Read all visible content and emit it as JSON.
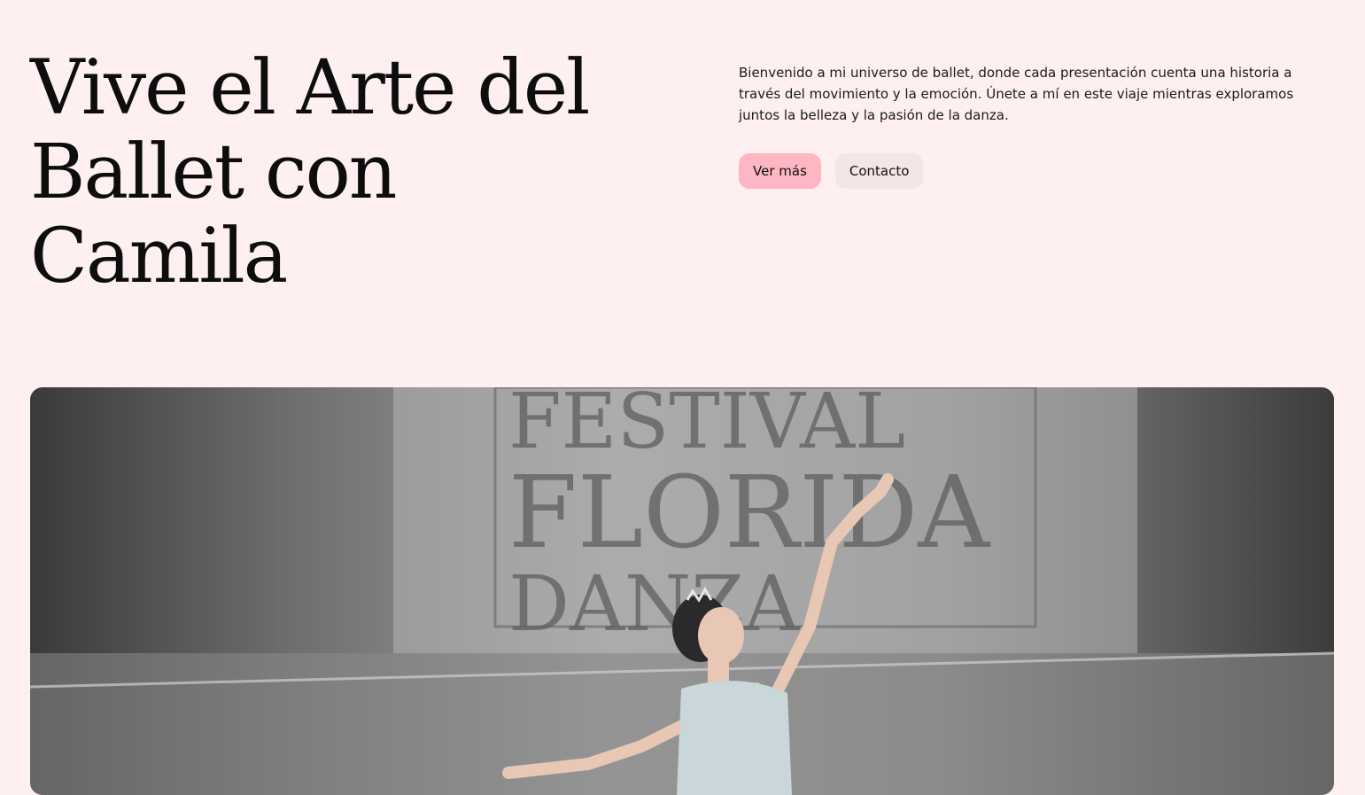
{
  "hero": {
    "title_lines": [
      "Vive el Arte del",
      "Ballet con",
      "Camila"
    ],
    "intro": "Bienvenido a mi universo de ballet, donde cada presentación cuenta una historia a través del movimiento y la emoción. Únete a mí en este viaje mientras exploramos juntos la belleza y la pasión de la danza.",
    "primary_button": "Ver más",
    "secondary_button": "Contacto"
  },
  "photo": {
    "banner_lines": [
      "FESTIVAL",
      "FLORIDA",
      "DANZA"
    ]
  },
  "colors": {
    "background": "#fef0f0",
    "primary_button": "#fdb6c2",
    "secondary_button": "#f4e6e7"
  }
}
